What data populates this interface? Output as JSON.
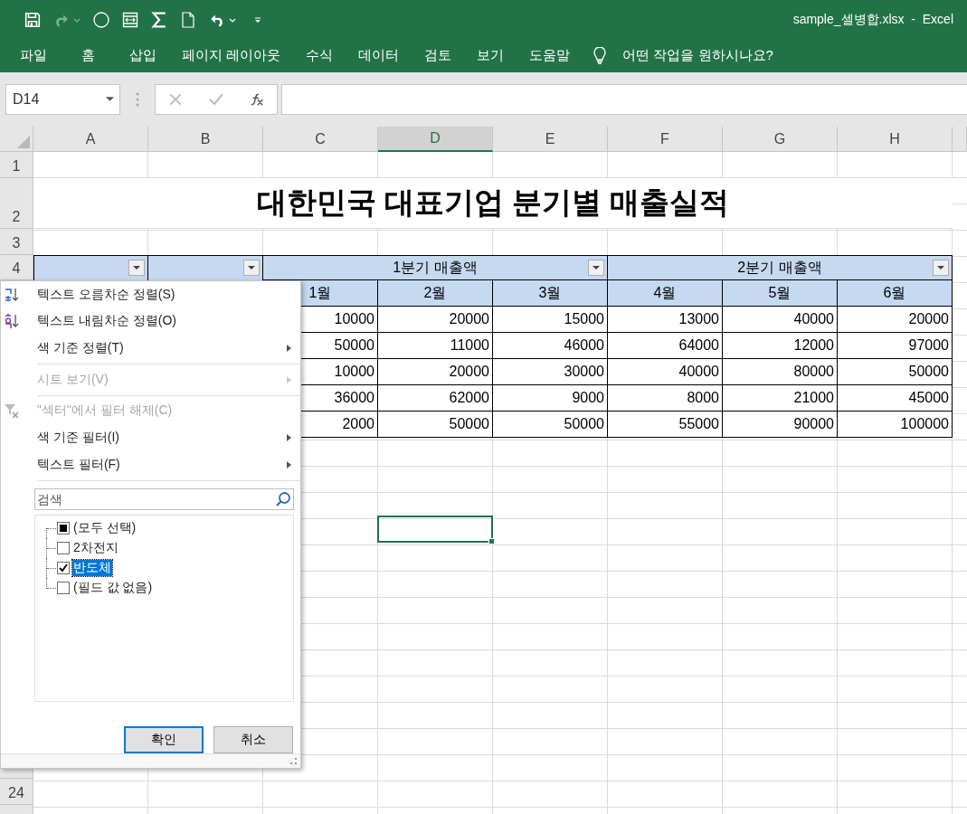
{
  "window": {
    "title": "sample_셀병합.xlsx  -  Excel"
  },
  "ribbon_tabs": [
    "파일",
    "홈",
    "삽입",
    "페이지 레이아웃",
    "수식",
    "데이터",
    "검토",
    "보기",
    "도움말"
  ],
  "tell_me": {
    "placeholder": "어떤 작업을 원하시나요?"
  },
  "name_box": {
    "value": "D14"
  },
  "columns": [
    {
      "label": "A",
      "selected": false
    },
    {
      "label": "B",
      "selected": false
    },
    {
      "label": "C",
      "selected": false
    },
    {
      "label": "D",
      "selected": true
    },
    {
      "label": "E",
      "selected": false
    },
    {
      "label": "F",
      "selected": false
    },
    {
      "label": "G",
      "selected": false
    },
    {
      "label": "H",
      "selected": false
    }
  ],
  "row_headers": [
    "1",
    "2",
    "3",
    "4"
  ],
  "row_headers_below_menu": [
    "24"
  ],
  "sheet_title": "대한민국 대표기업 분기별 매출실적",
  "table": {
    "key_headers": [
      {
        "filter_button": true
      },
      {
        "filter_button": true
      }
    ],
    "groups": [
      {
        "label": "1분기 매출액",
        "filter_button": true,
        "months": [
          "1월",
          "2월",
          "3월"
        ]
      },
      {
        "label": "2분기 매출액",
        "filter_button": true,
        "months": [
          "4월",
          "5월",
          "6월"
        ]
      }
    ],
    "rows": [
      [
        "10000",
        "20000",
        "15000",
        "13000",
        "40000",
        "20000"
      ],
      [
        "50000",
        "11000",
        "46000",
        "64000",
        "12000",
        "97000"
      ],
      [
        "10000",
        "20000",
        "30000",
        "40000",
        "80000",
        "50000"
      ],
      [
        "36000",
        "62000",
        "9000",
        "8000",
        "21000",
        "45000"
      ],
      [
        "2000",
        "50000",
        "50000",
        "55000",
        "90000",
        "100000"
      ]
    ]
  },
  "filter_menu": {
    "items": [
      {
        "label": "텍스트 오름차순 정렬(S)",
        "kind": "sort-asc",
        "disabled": false,
        "submenu": false,
        "separator_after": false
      },
      {
        "label": "텍스트 내림차순 정렬(O)",
        "kind": "sort-desc",
        "disabled": false,
        "submenu": false,
        "separator_after": false
      },
      {
        "label": "색 기준 정렬(T)",
        "kind": "plain",
        "disabled": false,
        "submenu": true,
        "separator_after": true
      },
      {
        "label": "시트 보기(V)",
        "kind": "plain",
        "disabled": true,
        "submenu": true,
        "separator_after": true
      },
      {
        "label": "\"섹터\"에서 필터 해제(C)",
        "kind": "clear-filter",
        "disabled": true,
        "submenu": false,
        "separator_after": false
      },
      {
        "label": "색 기준 필터(I)",
        "kind": "plain",
        "disabled": false,
        "submenu": true,
        "separator_after": false
      },
      {
        "label": "텍스트 필터(F)",
        "kind": "plain",
        "disabled": false,
        "submenu": true,
        "separator_after": true
      }
    ],
    "search": {
      "placeholder": "검색"
    },
    "values": [
      {
        "label": "(모두 선택)",
        "checked": false,
        "partial": true,
        "selected": false
      },
      {
        "label": "2차전지",
        "checked": false,
        "partial": false,
        "selected": false
      },
      {
        "label": "반도체",
        "checked": true,
        "partial": false,
        "selected": true
      },
      {
        "label": "(필드 값 없음)",
        "checked": false,
        "partial": false,
        "selected": false
      }
    ],
    "buttons": [
      {
        "label": "확인",
        "default": true
      },
      {
        "label": "취소",
        "default": false
      }
    ]
  }
}
